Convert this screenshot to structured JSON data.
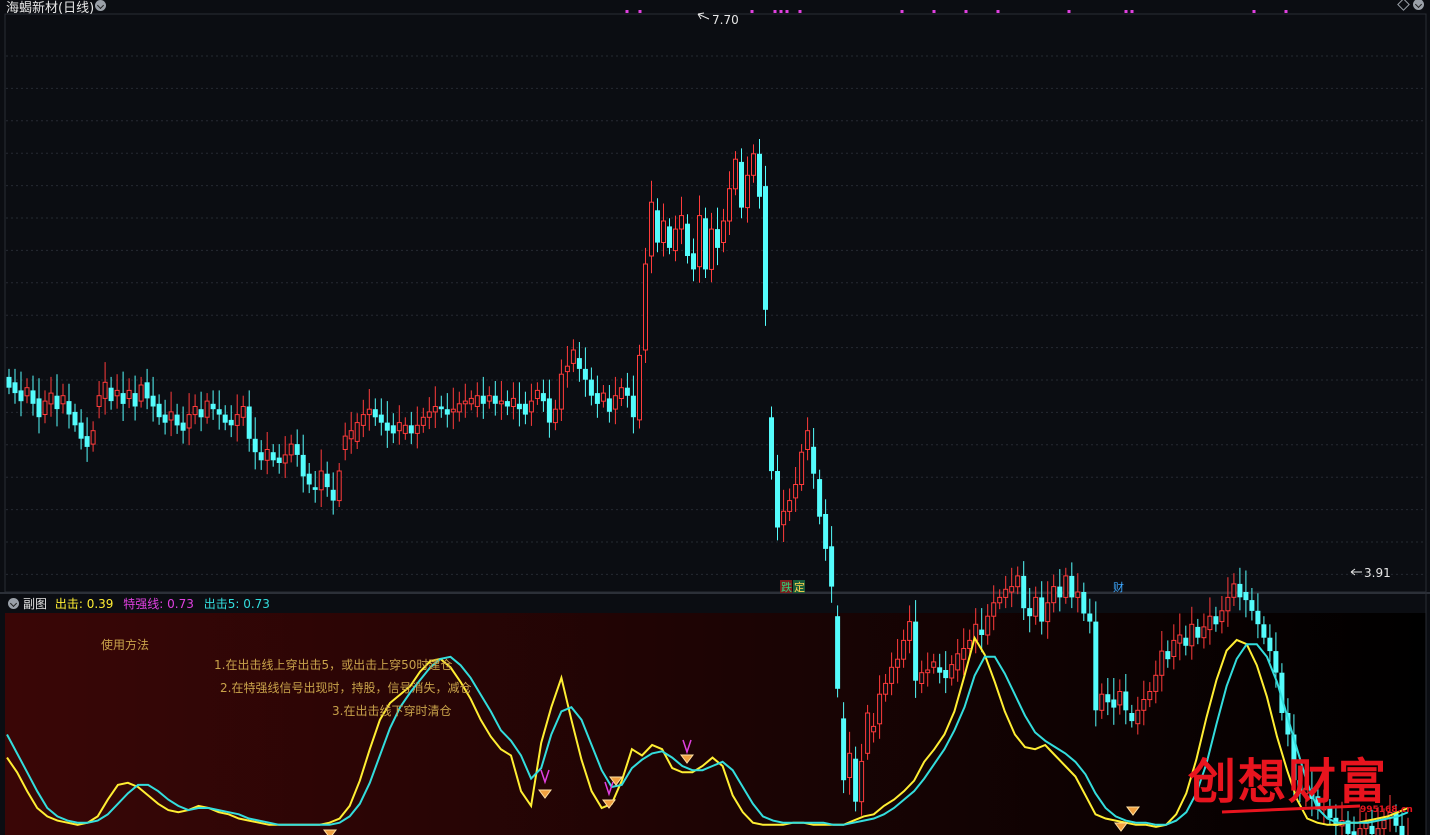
{
  "main_panel": {
    "title": "海蝎新材(日线)",
    "high_label": "7.70",
    "low_label": "3.91",
    "marker_labels": [
      {
        "text": "跌",
        "color": "#2fd37a",
        "bg": "#7a1e1e"
      },
      {
        "text": "定",
        "color": "#ffd24d",
        "bg": "#1a5c3a"
      },
      {
        "text": "财",
        "color": "#3da7ff",
        "bg": ""
      }
    ]
  },
  "sub_panel": {
    "title": "副图",
    "indicators": [
      {
        "name": "出击",
        "value": "0.39",
        "color": "#ffee33"
      },
      {
        "name": "特强线",
        "value": "0.73",
        "color": "#e040e0"
      },
      {
        "name": "出击5",
        "value": "0.73",
        "color": "#33dddd"
      }
    ],
    "instructions": {
      "heading": "使用方法",
      "line1": "1.在出击线上穿出击5，或出击上穿50时建仓",
      "line2": "2.在特强线信号出现时，持股，信号消失，减仓",
      "line3": "3.在出击线下穿时清仓"
    },
    "watermark": {
      "text": "创想财富",
      "url": "995168.cn",
      "color": "#e8141e"
    }
  },
  "chart_data": [
    {
      "type": "candlestick",
      "title": "海蝎新材(日线)",
      "ylim": [
        3.6,
        7.9
      ],
      "up_color": "#ff3b3b",
      "down_color": "#54fcfc",
      "candles": [
        [
          5.2,
          5.12
        ],
        [
          5.16,
          5.08
        ],
        [
          5.1,
          5.02
        ],
        [
          5.06,
          5.12
        ],
        [
          5.1,
          5.0
        ],
        [
          5.04,
          4.9
        ],
        [
          4.92,
          5.02
        ],
        [
          5.0,
          5.08
        ],
        [
          5.06,
          4.96
        ],
        [
          5.0,
          5.06
        ],
        [
          5.02,
          4.92
        ],
        [
          4.94,
          4.84
        ],
        [
          4.86,
          4.74
        ],
        [
          4.76,
          4.68
        ],
        [
          4.7,
          4.8
        ],
        [
          4.98,
          5.06
        ],
        [
          5.04,
          5.16
        ],
        [
          5.12,
          5.02
        ],
        [
          5.06,
          5.1
        ],
        [
          5.08,
          5.0
        ],
        [
          5.04,
          5.1
        ],
        [
          5.08,
          4.98
        ],
        [
          5.02,
          5.14
        ],
        [
          5.16,
          5.04
        ],
        [
          5.06,
          4.98
        ],
        [
          5.0,
          4.9
        ],
        [
          4.92,
          4.86
        ],
        [
          4.88,
          4.94
        ],
        [
          4.92,
          4.84
        ],
        [
          4.86,
          4.8
        ],
        [
          4.82,
          4.92
        ],
        [
          4.92,
          4.98
        ],
        [
          4.96,
          4.9
        ],
        [
          4.9,
          5.02
        ],
        [
          5.0,
          4.96
        ],
        [
          4.96,
          4.92
        ],
        [
          4.92,
          4.86
        ],
        [
          4.88,
          4.84
        ],
        [
          4.84,
          4.92
        ],
        [
          4.9,
          4.98
        ],
        [
          4.98,
          4.74
        ],
        [
          4.74,
          4.64
        ],
        [
          4.64,
          4.58
        ],
        [
          4.58,
          4.66
        ],
        [
          4.64,
          4.58
        ],
        [
          4.6,
          4.56
        ],
        [
          4.56,
          4.62
        ],
        [
          4.62,
          4.7
        ],
        [
          4.7,
          4.62
        ],
        [
          4.62,
          4.46
        ],
        [
          4.48,
          4.4
        ],
        [
          4.38,
          4.36
        ],
        [
          4.36,
          4.5
        ],
        [
          4.48,
          4.38
        ],
        [
          4.36,
          4.28
        ],
        [
          4.28,
          4.5
        ],
        [
          4.66,
          4.76
        ],
        [
          4.74,
          4.8
        ],
        [
          4.72,
          4.86
        ],
        [
          4.84,
          4.92
        ],
        [
          4.92,
          4.96
        ],
        [
          4.96,
          4.9
        ],
        [
          4.92,
          4.86
        ],
        [
          4.86,
          4.8
        ],
        [
          4.84,
          4.78
        ],
        [
          4.8,
          4.86
        ],
        [
          4.78,
          4.84
        ],
        [
          4.84,
          4.78
        ],
        [
          4.78,
          4.84
        ],
        [
          4.84,
          4.9
        ],
        [
          4.9,
          4.94
        ],
        [
          4.94,
          4.98
        ],
        [
          4.98,
          4.96
        ],
        [
          4.96,
          4.92
        ],
        [
          4.94,
          4.96
        ],
        [
          4.94,
          5.0
        ],
        [
          5.0,
          5.02
        ],
        [
          5.0,
          5.04
        ],
        [
          4.98,
          5.06
        ],
        [
          5.06,
          5.0
        ],
        [
          5.02,
          5.06
        ],
        [
          5.06,
          5.0
        ],
        [
          5.0,
          5.02
        ],
        [
          5.02,
          4.98
        ],
        [
          4.98,
          5.04
        ],
        [
          5.0,
          4.96
        ],
        [
          5.0,
          4.92
        ],
        [
          4.94,
          5.02
        ],
        [
          5.04,
          5.1
        ],
        [
          5.08,
          5.02
        ],
        [
          5.04,
          4.86
        ],
        [
          4.86,
          4.96
        ],
        [
          4.96,
          5.22
        ],
        [
          5.24,
          5.28
        ],
        [
          5.3,
          5.4
        ],
        [
          5.34,
          5.26
        ],
        [
          5.26,
          5.18
        ],
        [
          5.18,
          5.06
        ],
        [
          5.08,
          5.0
        ],
        [
          5.02,
          5.08
        ],
        [
          5.04,
          4.94
        ],
        [
          4.96,
          5.06
        ],
        [
          5.04,
          5.12
        ],
        [
          5.12,
          5.06
        ],
        [
          5.06,
          4.9
        ],
        [
          4.88,
          5.36
        ],
        [
          5.4,
          6.04
        ],
        [
          6.1,
          6.5
        ],
        [
          6.44,
          6.2
        ],
        [
          6.2,
          6.36
        ],
        [
          6.32,
          6.16
        ],
        [
          6.14,
          6.3
        ],
        [
          6.3,
          6.4
        ],
        [
          6.34,
          6.1
        ],
        [
          6.12,
          6.0
        ],
        [
          6.02,
          6.4
        ],
        [
          6.38,
          6.0
        ],
        [
          6.0,
          6.3
        ],
        [
          6.3,
          6.16
        ],
        [
          6.2,
          6.36
        ],
        [
          6.36,
          6.6
        ],
        [
          6.6,
          6.82
        ],
        [
          6.8,
          6.46
        ],
        [
          6.46,
          6.7
        ],
        [
          6.7,
          6.86
        ],
        [
          6.86,
          6.54
        ],
        [
          6.62,
          5.7
        ],
        [
          4.9,
          4.5
        ],
        [
          4.5,
          4.08
        ],
        [
          4.1,
          4.2
        ],
        [
          4.2,
          4.28
        ],
        [
          4.3,
          4.4
        ],
        [
          4.4,
          4.64
        ],
        [
          4.66,
          4.8
        ],
        [
          4.68,
          4.48
        ],
        [
          4.44,
          4.16
        ],
        [
          4.18,
          3.92
        ],
        [
          3.94,
          3.64
        ],
        [
          3.42,
          2.88
        ],
        [
          2.66,
          2.2
        ],
        [
          2.22,
          2.4
        ],
        [
          2.36,
          2.04
        ],
        [
          2.04,
          2.34
        ],
        [
          2.4,
          2.7
        ],
        [
          2.56,
          2.6
        ],
        [
          2.62,
          2.84
        ],
        [
          2.84,
          2.92
        ],
        [
          2.92,
          3.04
        ],
        [
          3.04,
          3.1
        ],
        [
          3.1,
          3.24
        ],
        [
          3.24,
          3.38
        ],
        [
          3.38,
          2.94
        ],
        [
          2.92,
          3.0
        ],
        [
          3.0,
          3.02
        ],
        [
          3.04,
          3.08
        ],
        [
          3.04,
          3.0
        ],
        [
          3.02,
          2.96
        ],
        [
          2.96,
          3.06
        ],
        [
          3.02,
          3.14
        ],
        [
          3.1,
          3.18
        ],
        [
          3.18,
          3.24
        ],
        [
          3.24,
          3.36
        ],
        [
          3.32,
          3.28
        ],
        [
          3.28,
          3.42
        ],
        [
          3.42,
          3.52
        ],
        [
          3.52,
          3.56
        ],
        [
          3.56,
          3.62
        ],
        [
          3.6,
          3.64
        ],
        [
          3.64,
          3.72
        ],
        [
          3.72,
          3.48
        ],
        [
          3.48,
          3.42
        ],
        [
          3.42,
          3.56
        ],
        [
          3.56,
          3.38
        ],
        [
          3.38,
          3.52
        ],
        [
          3.52,
          3.64
        ],
        [
          3.64,
          3.56
        ],
        [
          3.56,
          3.72
        ],
        [
          3.72,
          3.56
        ],
        [
          3.56,
          3.6
        ],
        [
          3.6,
          3.44
        ],
        [
          3.44,
          3.38
        ],
        [
          3.38,
          2.72
        ],
        [
          2.72,
          2.84
        ],
        [
          2.84,
          2.78
        ],
        [
          2.8,
          2.74
        ],
        [
          2.76,
          2.86
        ],
        [
          2.86,
          2.72
        ],
        [
          2.7,
          2.64
        ],
        [
          2.62,
          2.72
        ],
        [
          2.72,
          2.8
        ],
        [
          2.8,
          2.86
        ],
        [
          2.86,
          2.98
        ],
        [
          2.98,
          3.16
        ],
        [
          3.16,
          3.1
        ],
        [
          3.12,
          3.24
        ],
        [
          3.22,
          3.28
        ],
        [
          3.26,
          3.2
        ],
        [
          3.2,
          3.36
        ],
        [
          3.34,
          3.26
        ],
        [
          3.26,
          3.34
        ],
        [
          3.32,
          3.42
        ],
        [
          3.42,
          3.36
        ],
        [
          3.38,
          3.46
        ],
        [
          3.46,
          3.56
        ],
        [
          3.56,
          3.66
        ],
        [
          3.66,
          3.56
        ],
        [
          3.6,
          3.54
        ],
        [
          3.54,
          3.46
        ],
        [
          3.46,
          3.36
        ],
        [
          3.36,
          3.26
        ],
        [
          3.26,
          3.16
        ],
        [
          3.16,
          3.0
        ],
        [
          3.0,
          2.7
        ],
        [
          2.7,
          2.54
        ],
        [
          2.54,
          2.2
        ],
        [
          2.2,
          2.1
        ],
        [
          2.1,
          2.14
        ],
        [
          2.12,
          2.06
        ],
        [
          2.08,
          1.98
        ],
        [
          1.98,
          2.0
        ],
        [
          2.0,
          1.92
        ],
        [
          1.92,
          1.86
        ],
        [
          1.86,
          1.9
        ],
        [
          1.9,
          1.8
        ],
        [
          1.82,
          1.74
        ],
        [
          1.72,
          1.84
        ],
        [
          1.84,
          1.88
        ],
        [
          1.86,
          1.8
        ],
        [
          1.78,
          1.84
        ],
        [
          1.84,
          1.9
        ],
        [
          1.92,
          1.96
        ],
        [
          1.96,
          1.86
        ],
        [
          1.86,
          1.72
        ],
        [
          1.7,
          1.78
        ]
      ]
    },
    {
      "type": "line",
      "title": "副图",
      "ylim": [
        0,
        100
      ],
      "series": [
        {
          "name": "出击",
          "color": "#ffee33",
          "values": [
            34,
            27,
            18,
            10,
            6,
            4,
            3,
            2,
            3,
            6,
            14,
            21,
            22,
            20,
            16,
            12,
            9,
            8,
            9,
            11,
            10,
            8,
            7,
            5,
            4,
            3,
            2,
            2,
            2,
            2,
            2,
            2,
            3,
            5,
            11,
            23,
            38,
            52,
            60,
            64,
            68,
            75,
            80,
            81,
            77,
            70,
            62,
            52,
            44,
            38,
            35,
            18,
            11,
            41,
            58,
            72,
            52,
            33,
            18,
            10,
            12,
            23,
            38,
            35,
            40,
            38,
            29,
            27,
            27,
            30,
            34,
            30,
            16,
            8,
            3,
            2,
            2,
            2,
            3,
            3,
            2,
            2,
            2,
            2,
            4,
            6,
            7,
            11,
            14,
            18,
            23,
            32,
            38,
            45,
            56,
            73,
            91,
            83,
            70,
            56,
            45,
            39,
            38,
            40,
            35,
            30,
            25,
            16,
            7,
            5,
            4,
            3,
            2,
            2,
            1,
            2,
            7,
            17,
            33,
            53,
            71,
            85,
            90,
            88,
            78,
            63,
            44,
            28,
            14,
            5,
            3,
            2,
            2,
            3,
            3,
            4,
            5,
            6,
            8,
            10
          ]
        },
        {
          "name": "出击5",
          "color": "#33dddd",
          "values": [
            45,
            36,
            27,
            18,
            10,
            6,
            4,
            3,
            3,
            4,
            7,
            12,
            17,
            21,
            21,
            18,
            14,
            11,
            9,
            10,
            10,
            9,
            8,
            7,
            5,
            4,
            3,
            2,
            2,
            2,
            2,
            2,
            2,
            3,
            6,
            12,
            22,
            35,
            48,
            58,
            65,
            71,
            77,
            81,
            82,
            78,
            72,
            64,
            56,
            47,
            42,
            35,
            24,
            29,
            45,
            56,
            58,
            52,
            40,
            28,
            20,
            21,
            29,
            33,
            36,
            37,
            34,
            30,
            28,
            28,
            30,
            32,
            28,
            20,
            12,
            6,
            4,
            3,
            3,
            3,
            3,
            3,
            2,
            2,
            3,
            4,
            5,
            7,
            10,
            14,
            18,
            24,
            31,
            38,
            47,
            58,
            73,
            82,
            82,
            74,
            64,
            54,
            46,
            42,
            39,
            36,
            32,
            26,
            17,
            10,
            6,
            4,
            3,
            3,
            2,
            2,
            4,
            8,
            17,
            31,
            50,
            68,
            81,
            88,
            88,
            82,
            70,
            54,
            38,
            22,
            10,
            5,
            3,
            3,
            3,
            3,
            4,
            5,
            6,
            8
          ]
        }
      ]
    }
  ]
}
